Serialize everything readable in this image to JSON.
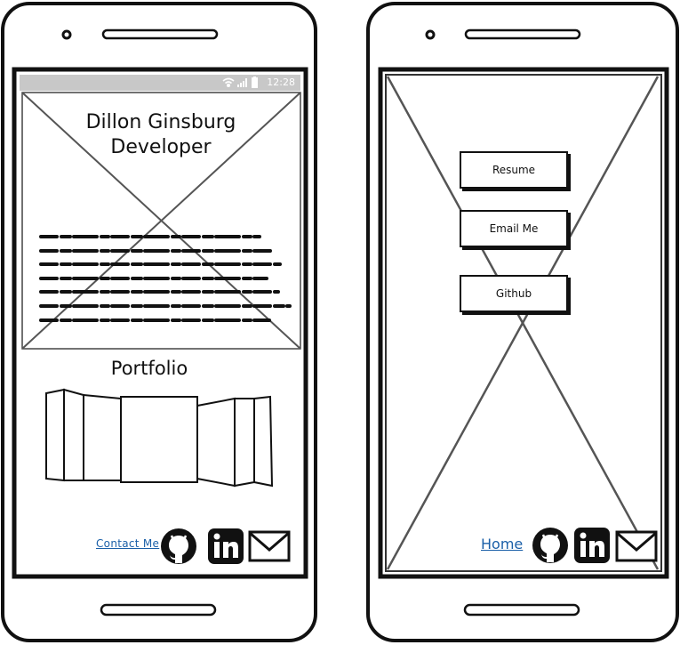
{
  "left_phone": {
    "status_time": "12:28",
    "title_line1": "Dillon Ginsburg",
    "title_line2": "Developer",
    "portfolio_heading": "Portfolio",
    "contact_link": "Contact Me"
  },
  "right_phone": {
    "buttons": [
      "Resume",
      "Email Me",
      "Github"
    ],
    "home_link": "Home"
  },
  "icons": [
    "github-icon",
    "linkedin-icon",
    "mail-icon",
    "wifi-icon",
    "signal-icon",
    "battery-icon"
  ],
  "colors": {
    "link": "#1a5fa8",
    "status_bar": "#c8c8c8",
    "ink": "#111111"
  }
}
